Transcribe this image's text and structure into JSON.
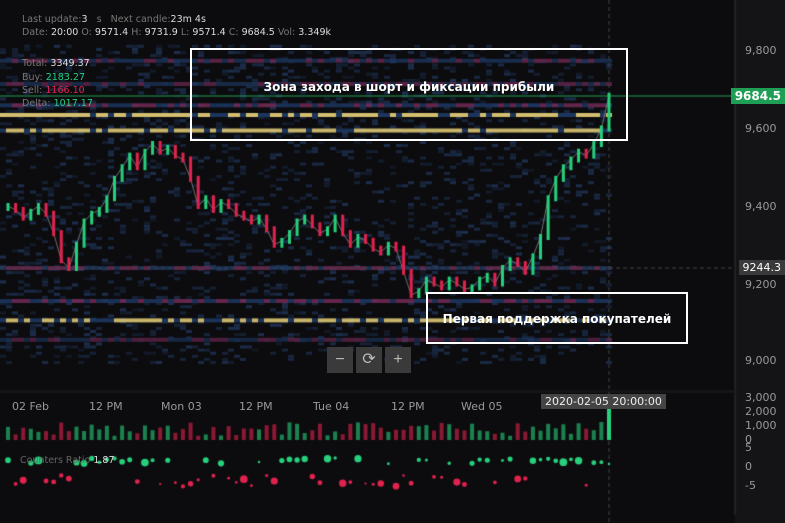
{
  "info": {
    "last_update_label": "Last update:",
    "last_update": "3",
    "last_update_unit": "s",
    "next_candle_label": "Next candle:",
    "next_candle": "23m 4s",
    "date_label": "Date:",
    "date": "20:00",
    "o_label": "O:",
    "o": "9571.4",
    "h_label": "H:",
    "h": "9731.9",
    "l_label": "L:",
    "l": "9571.4",
    "c_label": "C:",
    "c": "9684.5",
    "vol_label": "Vol:",
    "vol": "3.349k",
    "total_label": "Total:",
    "total": "3349.37",
    "buy_label": "Buy:",
    "buy": "2183.27",
    "sell_label": "Sell:",
    "sell": "1166.10",
    "delta_label": "Delta:",
    "delta": "1017.17"
  },
  "annotations": {
    "short_zone": "Зона захода в шорт и фиксации прибыли",
    "support": "Первая поддержка покупателей"
  },
  "current_price": "9684.5",
  "crosshair_price": "9244.3",
  "crosshair_time": "2020-02-05 20:00:00",
  "zoom_controls": {
    "minus": "−",
    "reset": "⟳",
    "plus": "+"
  },
  "counters_label": "Counters Ratio",
  "counters_value": "1.87",
  "colors": {
    "up": "#26d07c",
    "down": "#e0234e",
    "current": "#1f9e55",
    "heat_low": "#1e3a66",
    "heat_mid": "#7a2c5a",
    "heat_high": "#e9d27a"
  },
  "chart_data": {
    "type": "heatmap",
    "title": "Order book heatmap with candlesticks",
    "price_axis": {
      "ticks": [
        "9,800",
        "9,600",
        "9,400",
        "9,200",
        "9,000"
      ],
      "range": [
        8950,
        9920
      ]
    },
    "time_axis": {
      "ticks": [
        "02 Feb",
        "12 PM",
        "Mon 03",
        "12 PM",
        "Tue 04",
        "12 PM",
        "Wed 05"
      ]
    },
    "volume_axis": {
      "ticks": [
        "3,000",
        "2,000",
        "1,000",
        "0"
      ]
    },
    "ratio_axis": {
      "ticks": [
        "5",
        "0",
        "-5"
      ]
    },
    "heat_levels": [
      {
        "price": 9780,
        "intensity": 0.6
      },
      {
        "price": 9720,
        "intensity": 0.5
      },
      {
        "price": 9665,
        "intensity": 0.8
      },
      {
        "price": 9640,
        "intensity": 1.0
      },
      {
        "price": 9600,
        "intensity": 0.9
      },
      {
        "price": 9245,
        "intensity": 0.7
      },
      {
        "price": 9160,
        "intensity": 0.8
      },
      {
        "price": 9110,
        "intensity": 0.9
      },
      {
        "price": 9060,
        "intensity": 0.4
      }
    ],
    "closes": [
      9400,
      9390,
      9370,
      9385,
      9400,
      9380,
      9330,
      9260,
      9240,
      9300,
      9360,
      9380,
      9390,
      9420,
      9470,
      9500,
      9530,
      9500,
      9540,
      9560,
      9540,
      9550,
      9530,
      9520,
      9470,
      9400,
      9420,
      9390,
      9410,
      9400,
      9380,
      9370,
      9360,
      9370,
      9340,
      9300,
      9310,
      9330,
      9360,
      9370,
      9350,
      9330,
      9340,
      9370,
      9330,
      9300,
      9320,
      9310,
      9290,
      9280,
      9300,
      9290,
      9230,
      9170,
      9180,
      9210,
      9200,
      9190,
      9210,
      9200,
      9185,
      9190,
      9210,
      9220,
      9200,
      9240,
      9260,
      9250,
      9230,
      9270,
      9320,
      9420,
      9470,
      9500,
      9520,
      9540,
      9530,
      9560,
      9600,
      9684.5
    ]
  }
}
